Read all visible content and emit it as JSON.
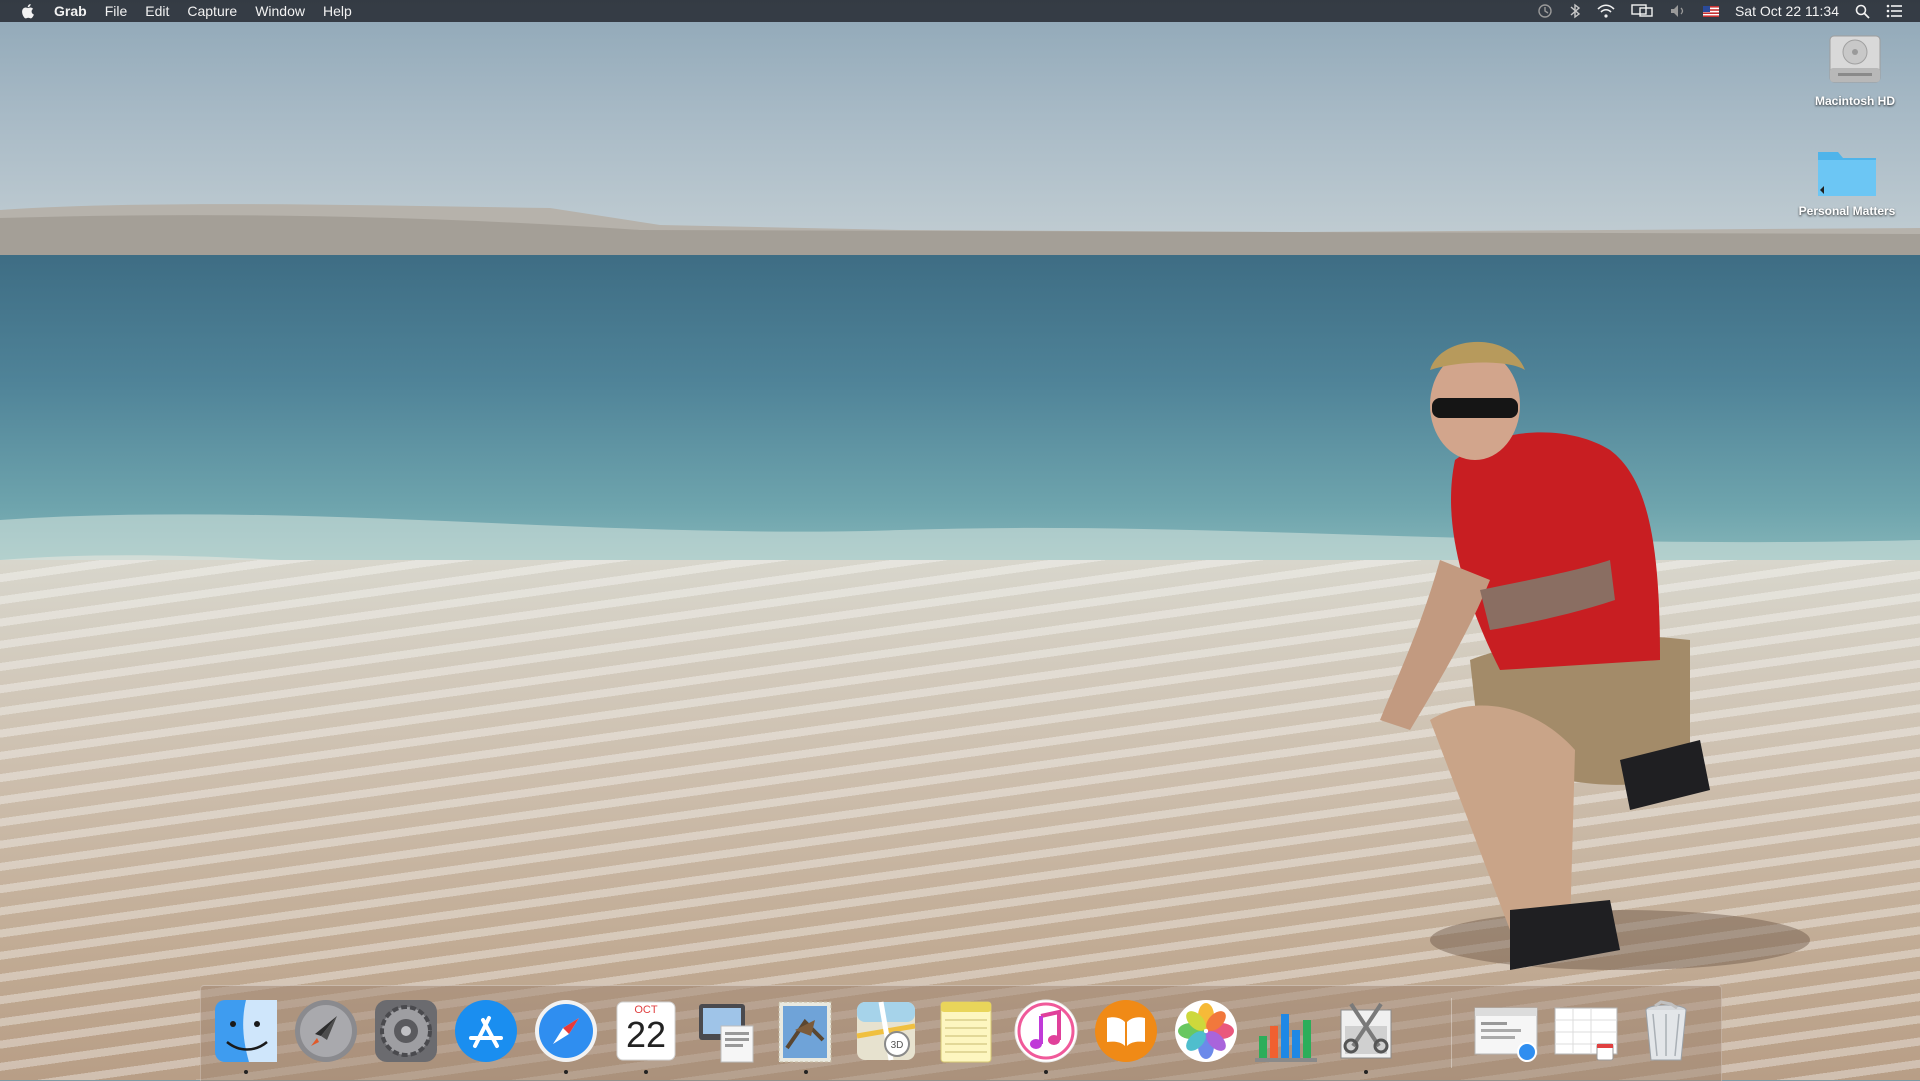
{
  "menubar": {
    "app_name": "Grab",
    "menus": [
      "File",
      "Edit",
      "Capture",
      "Window",
      "Help"
    ],
    "clock": "Sat Oct 22  11:34"
  },
  "desktop": {
    "icons": [
      {
        "label": "Macintosh HD"
      },
      {
        "label": "Personal Matters"
      }
    ]
  },
  "dock": {
    "calendar": {
      "month": "OCT",
      "day": "22"
    },
    "apps": [
      {
        "icon": "finder-icon",
        "running": true
      },
      {
        "icon": "launchpad-icon",
        "running": false
      },
      {
        "icon": "system-preferences-icon",
        "running": false
      },
      {
        "icon": "app-store-icon",
        "running": false
      },
      {
        "icon": "safari-icon",
        "running": true
      },
      {
        "icon": "calendar-icon",
        "running": true
      },
      {
        "icon": "preview-icon",
        "running": false
      },
      {
        "icon": "mail-icon",
        "running": true
      },
      {
        "icon": "maps-icon",
        "running": false
      },
      {
        "icon": "notes-icon",
        "running": false
      },
      {
        "icon": "itunes-icon",
        "running": true
      },
      {
        "icon": "ibooks-icon",
        "running": false
      },
      {
        "icon": "photos-icon",
        "running": false
      },
      {
        "icon": "numbers-icon",
        "running": false
      },
      {
        "icon": "grab-icon",
        "running": true
      },
      {
        "icon": "safari-document-icon",
        "running": false
      },
      {
        "icon": "calendar-document-icon",
        "running": false
      },
      {
        "icon": "trash-icon",
        "running": false
      }
    ]
  },
  "colors": {
    "menubar": "#282c34",
    "shirt": "#c81e22",
    "sea": "#4f8398",
    "folder": "#5bc0f0"
  }
}
